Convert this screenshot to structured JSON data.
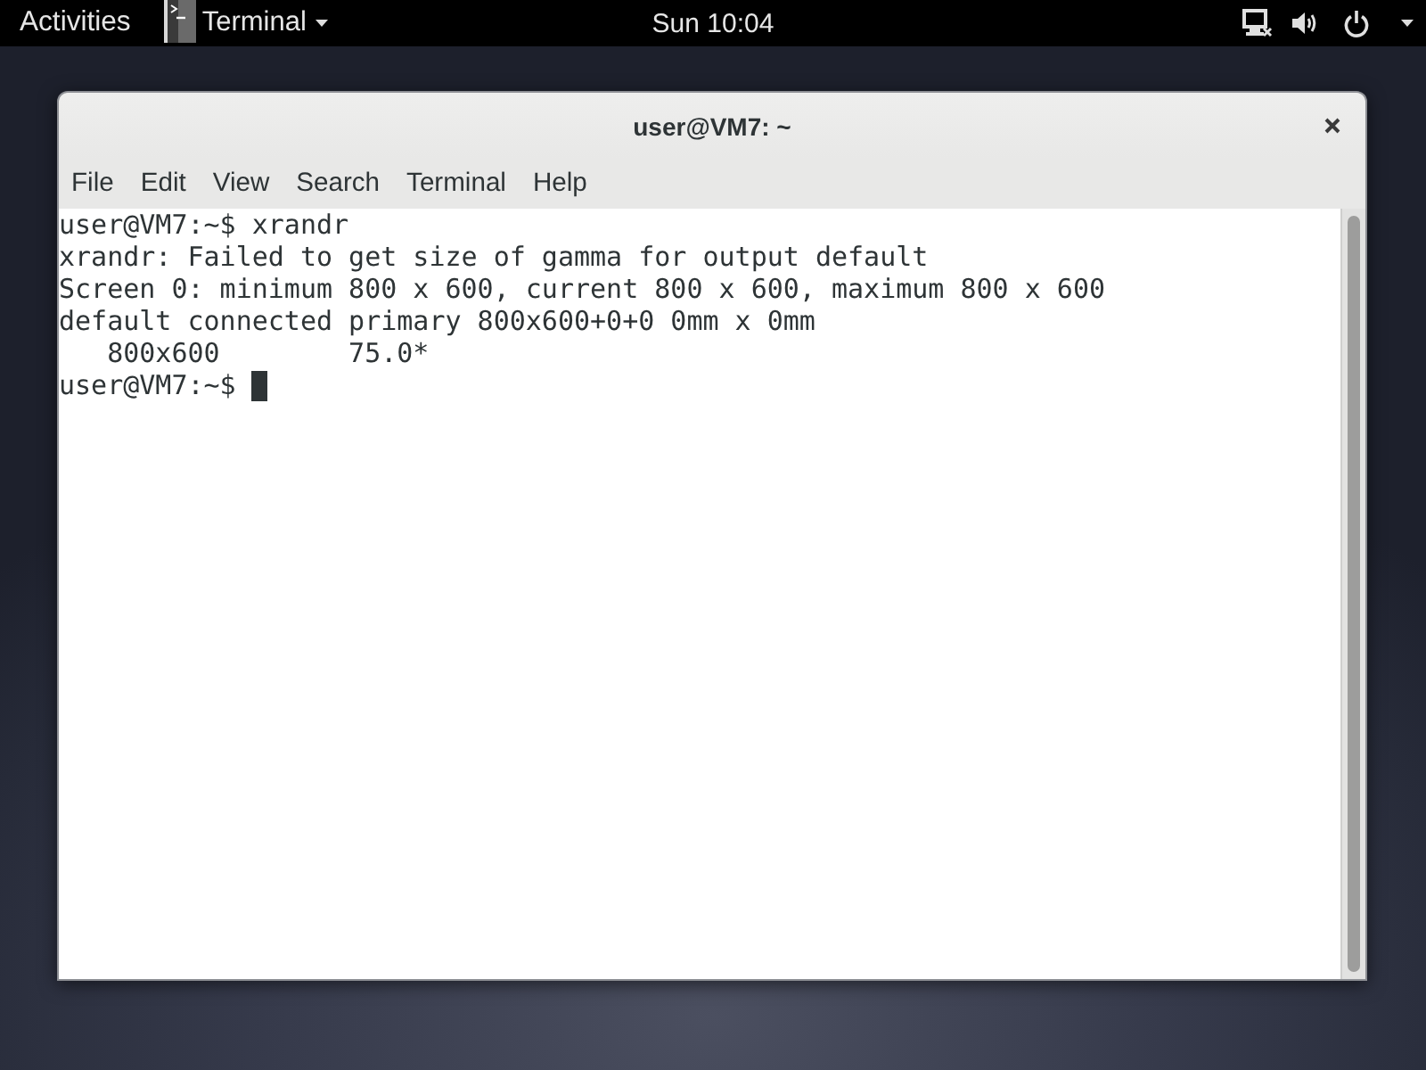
{
  "top_bar": {
    "activities": "Activities",
    "app_menu": {
      "label": "Terminal"
    },
    "clock": "Sun 10:04"
  },
  "window": {
    "title": "user@VM7: ~",
    "menu": [
      "File",
      "Edit",
      "View",
      "Search",
      "Terminal",
      "Help"
    ],
    "terminal": {
      "lines": [
        "user@VM7:~$ xrandr",
        "xrandr: Failed to get size of gamma for output default",
        "Screen 0: minimum 800 x 600, current 800 x 600, maximum 800 x 600",
        "default connected primary 800x600+0+0 0mm x 0mm",
        "   800x600        75.0*",
        "user@VM7:~$ "
      ]
    }
  }
}
